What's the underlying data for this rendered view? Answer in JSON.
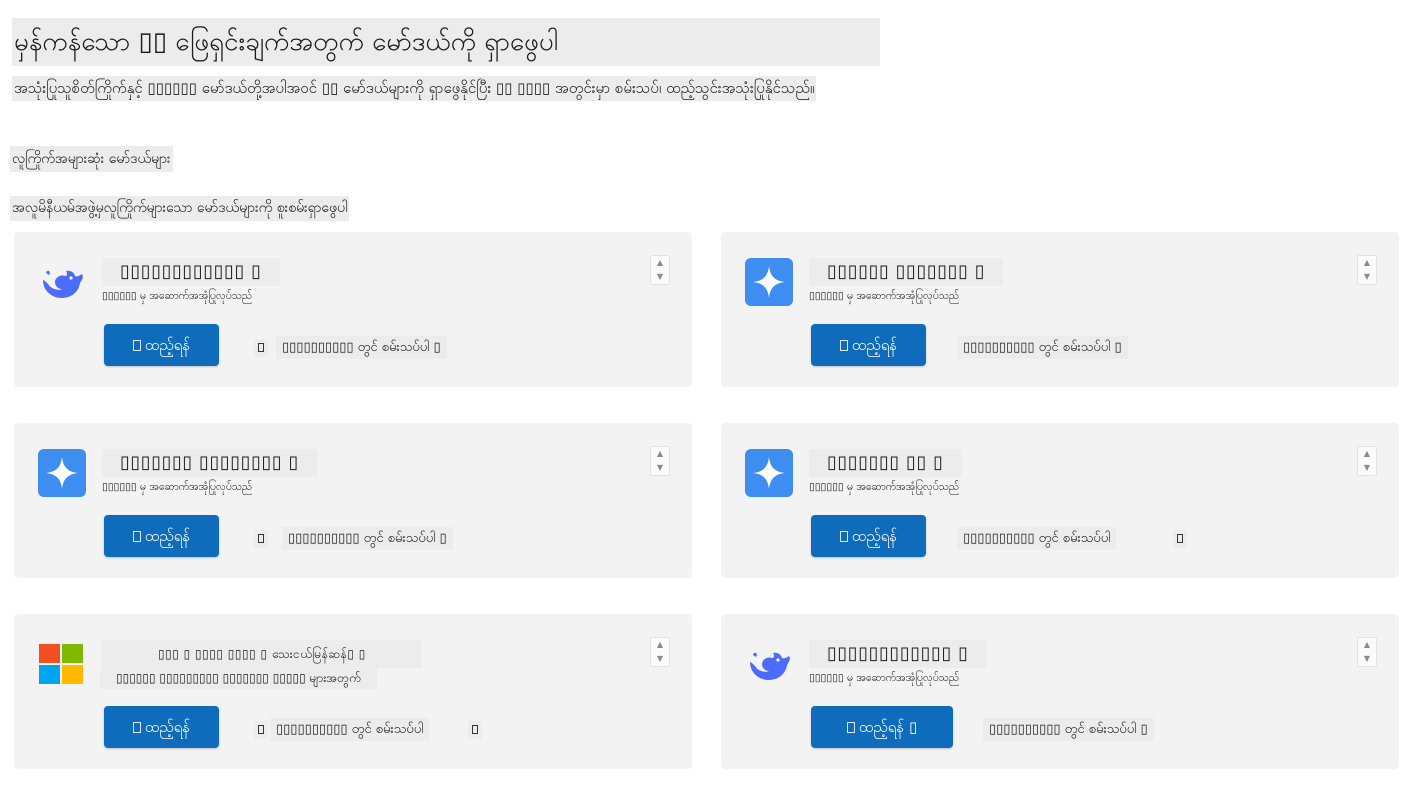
{
  "header": {
    "title": "မှန်ကန်သော ▯▯ ဖြေရှင်းချက်အတွက် မော်ဒယ်ကို ရှာဖွေပါ",
    "subtitle": "အသုံးပြုသူစိတ်ကြိုက်နှင့် ▯▯▯▯▯▯ မော်ဒယ်တို့အပါအဝင် ▯▯ မော်ဒယ်များကို ရှာဖွေနိုင်ပြီး ▯▯ ▯▯▯▯ အတွင်းမှာ စမ်းသပ်၊ ထည့်သွင်းအသုံးပြုနိုင်သည်။"
  },
  "section": {
    "heading": "လူကြိုက်အများဆုံး မော်ဒယ်များ",
    "description": "အလူမိနီယမ်အဖွဲ့မှလူကြိုက်များသော မော်ဒယ်များကို စူးစမ်းရှာဖွေပါ"
  },
  "cards": [
    {
      "logo": "deepseek-whale-icon",
      "title": "▯▯▯▯▯▯▯▯▯▯▯▯ ▯",
      "provider": "▯▯▯▯▯▯ မှ အဆောက်အအုံပြုလုပ်သည်",
      "install_label": "ထည့်ရန်",
      "try_label": "▯▯▯▯▯▯▯▯▯▯ တွင် စမ်းသပ်ပါ ▯"
    },
    {
      "logo": "gemini-sparkle-icon",
      "title": "▯▯▯▯▯▯ ▯▯▯▯▯▯▯ ▯",
      "provider": "▯▯▯▯▯▯ မှ အဆောက်အအုံပြုလုပ်သည်",
      "install_label": "ထည့်ရန်",
      "try_label": "▯▯▯▯▯▯▯▯▯▯ တွင် စမ်းသပ်ပါ ▯"
    },
    {
      "logo": "gemini-sparkle-icon",
      "title": "▯▯▯▯▯▯▯ ▯▯▯▯▯▯▯▯ ▯",
      "provider": "▯▯▯▯▯▯ မှ အဆောက်အအုံပြုလုပ်သည်",
      "install_label": "ထည့်ရန်",
      "try_label": "▯▯▯▯▯▯▯▯▯▯ တွင် စမ်းသပ်ပါ ▯"
    },
    {
      "logo": "gemini-sparkle-icon",
      "title": "▯▯▯▯▯▯▯ ▯▯ ▯",
      "provider": "▯▯▯▯▯▯ မှ အဆောက်အအုံပြုလုပ်သည်",
      "install_label": "ထည့်ရန်",
      "try_label": "▯▯▯▯▯▯▯▯▯▯ တွင် စမ်းသပ်ပါ"
    },
    {
      "logo": "microsoft-logo-icon",
      "title": "▯▯▯ ▯ ▯▯▯▯ ▯▯▯▯ ▯ သေးငယ်မြန်ဆန်▯ ▯",
      "provider": "▯▯▯▯▯▯ ▯▯▯▯▯▯▯▯▯ ▯▯▯▯▯▯▯ ▯▯▯▯▯ များအတွက်",
      "install_label": "ထည့်ရန်",
      "try_label": "▯▯▯▯▯▯▯▯▯▯ တွင် စမ်းသပ်ပါ"
    },
    {
      "logo": "deepseek-whale-icon",
      "title": "▯▯▯▯▯▯▯▯▯▯▯▯ ▯",
      "provider": "▯▯▯▯▯▯ မှ အဆောက်အအုံပြုလုပ်သည်",
      "install_label": "ထည့်ရန် ▯",
      "try_label": "▯▯▯▯▯▯▯▯▯▯ တွင် စမ်းသပ်ပါ ▯"
    }
  ],
  "colors": {
    "card_bg": "#f3f3f3",
    "install_button": "#0f6cbd",
    "deepseek_blue": "#4d6bfe",
    "gemini_blue": "#3d8ef0",
    "ms_red": "#f25022",
    "ms_green": "#7fba00",
    "ms_blue": "#00a4ef",
    "ms_yellow": "#ffb900"
  }
}
